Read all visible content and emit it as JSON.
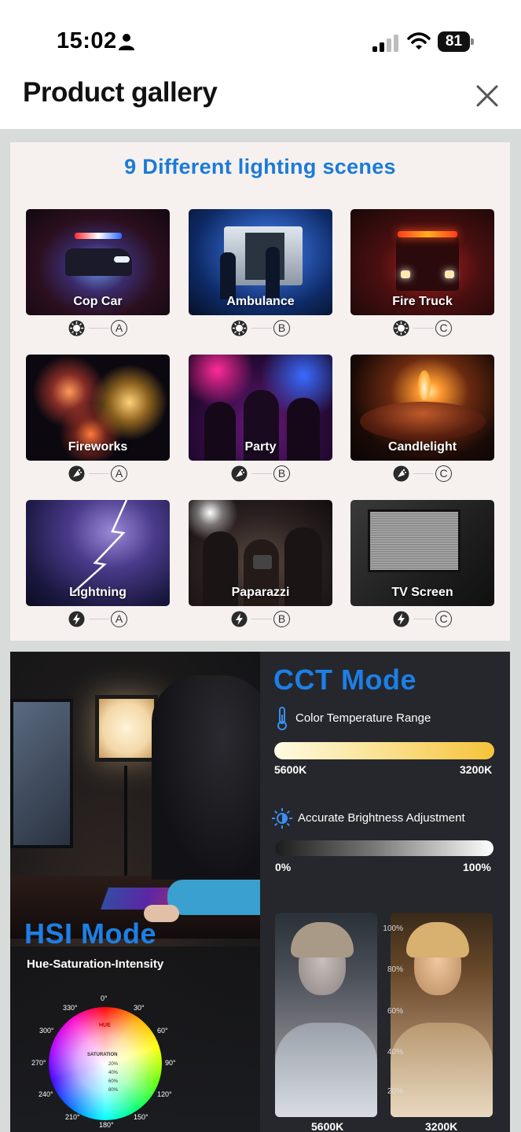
{
  "status_bar": {
    "time": "15:02",
    "battery": "81",
    "person_icon": "person-icon",
    "signal_icon": "signal-icon",
    "wifi_icon": "wifi-icon"
  },
  "header": {
    "title": "Product gallery",
    "close_icon": "close-icon"
  },
  "scenes_panel": {
    "title": "9 Different lighting scenes",
    "accent_color": "#1a7bd8",
    "scenes": [
      {
        "label": "Cop Car",
        "mode_letter": "A",
        "mode_icon": "strobe-icon"
      },
      {
        "label": "Ambulance",
        "mode_letter": "B",
        "mode_icon": "strobe-icon"
      },
      {
        "label": "Fire Truck",
        "mode_letter": "C",
        "mode_icon": "strobe-icon"
      },
      {
        "label": "Fireworks",
        "mode_letter": "A",
        "mode_icon": "firework-icon"
      },
      {
        "label": "Party",
        "mode_letter": "B",
        "mode_icon": "firework-icon"
      },
      {
        "label": "Candlelight",
        "mode_letter": "C",
        "mode_icon": "firework-icon"
      },
      {
        "label": "Lightning",
        "mode_letter": "A",
        "mode_icon": "lightning-icon"
      },
      {
        "label": "Paparazzi",
        "mode_letter": "B",
        "mode_icon": "lightning-icon"
      },
      {
        "label": "TV Screen",
        "mode_letter": "C",
        "mode_icon": "lightning-icon"
      }
    ]
  },
  "modes_panel": {
    "cct_title": "CCT Mode",
    "temp_label": "Color Temperature Range",
    "temp_min": "5600K",
    "temp_max": "3200K",
    "brightness_label": "Accurate Brightness Adjustment",
    "brightness_min": "0%",
    "brightness_max": "100%",
    "percent_scale": [
      "100%",
      "80%",
      "60%",
      "40%",
      "20%"
    ],
    "portrait_left_caption": "5600K",
    "portrait_right_caption": "3200K",
    "hsi_title": "HSI Mode",
    "hsi_subtitle": "Hue-Saturation-Intensity",
    "wheel": {
      "hue_label": "HUE",
      "saturation_label": "SATURATION",
      "saturation_steps": [
        "20%",
        "40%",
        "60%",
        "80%"
      ],
      "degrees": [
        "0°",
        "30°",
        "60°",
        "90°",
        "120°",
        "150°",
        "180°",
        "210°",
        "240°",
        "270°",
        "300°",
        "330°"
      ]
    },
    "accent_color": "#1d7fe6"
  }
}
